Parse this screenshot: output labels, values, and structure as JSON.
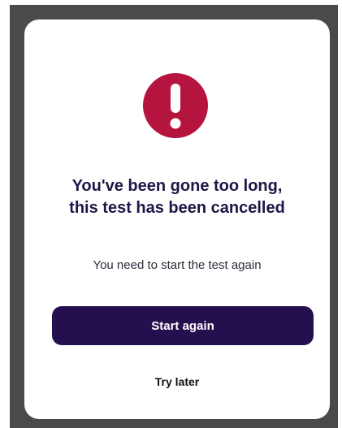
{
  "dialog": {
    "icon": "exclamation-alert-icon",
    "title": "You've been gone too long,\nthis test has been cancelled",
    "message": "You need to start the test again",
    "primary_label": "Start again",
    "secondary_label": "Try later"
  },
  "colors": {
    "backdrop": "#4a4a4a",
    "icon_circle": "#b5143f",
    "title_text": "#1f1547",
    "primary_button": "#25104f",
    "primary_button_text": "#ffffff"
  }
}
